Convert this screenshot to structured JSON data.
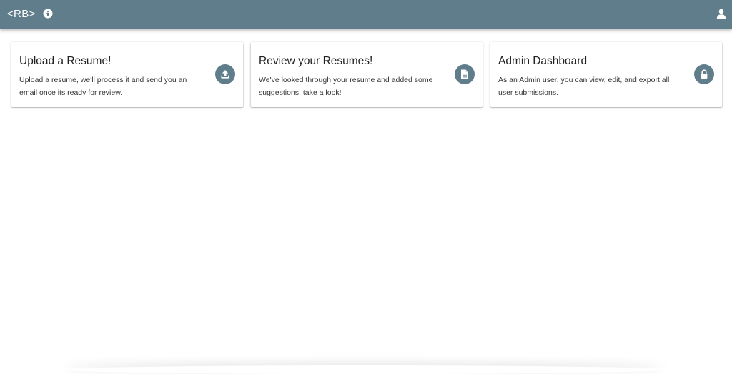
{
  "appbar": {
    "logo": "<RB>",
    "info_icon": "info-circle-icon",
    "user_icon": "user-icon",
    "color": "#607d8b"
  },
  "cards": [
    {
      "title": "Upload a Resume!",
      "text": "Upload a resume, we'll process it and send you an email once its ready for review.",
      "icon": "upload-icon"
    },
    {
      "title": "Review your Resumes!",
      "text": "We've looked through your resume and added some suggestions, take a look!",
      "icon": "document-icon"
    },
    {
      "title": "Admin Dashboard",
      "text": "As an Admin user, you can view, edit, and export all user submissions.",
      "icon": "lock-icon"
    }
  ]
}
